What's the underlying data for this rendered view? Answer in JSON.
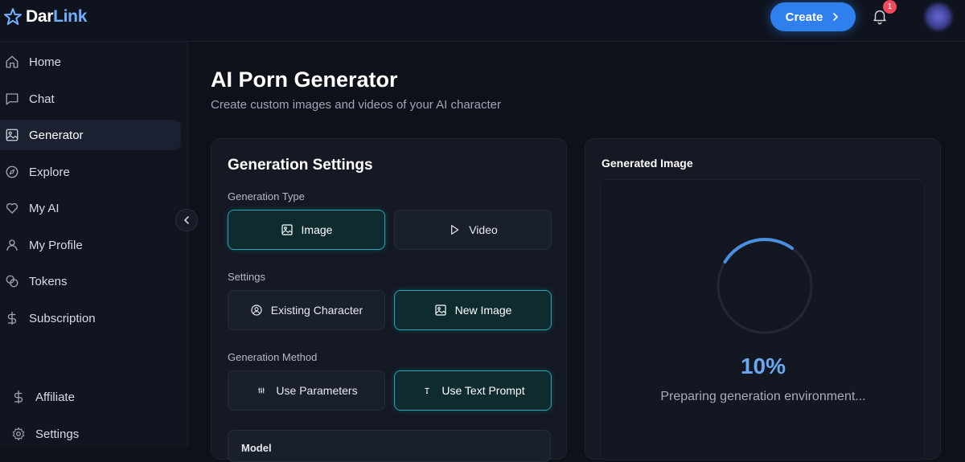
{
  "brand": {
    "name_part1": "Dar",
    "name_part2": "Link",
    "accent": "#6fb0ff"
  },
  "header": {
    "create_label": "Create",
    "notification_count": "1"
  },
  "sidebar": {
    "items": [
      {
        "label": "Home",
        "icon": "home-icon"
      },
      {
        "label": "Chat",
        "icon": "chat-icon"
      },
      {
        "label": "Generator",
        "icon": "image-icon",
        "active": true
      },
      {
        "label": "Explore",
        "icon": "compass-icon"
      },
      {
        "label": "My AI",
        "icon": "heart-icon"
      },
      {
        "label": "My Profile",
        "icon": "user-icon"
      },
      {
        "label": "Tokens",
        "icon": "coins-icon"
      },
      {
        "label": "Subscription",
        "icon": "dollar-icon"
      }
    ],
    "bottom_items": [
      {
        "label": "Affiliate",
        "icon": "dollar-icon"
      },
      {
        "label": "Settings",
        "icon": "gear-icon"
      }
    ]
  },
  "page": {
    "title": "AI Porn Generator",
    "subtitle": "Create custom images and videos of your AI character"
  },
  "settings": {
    "title": "Generation Settings",
    "generation_type": {
      "label": "Generation Type",
      "options": [
        {
          "label": "Image",
          "icon": "image-icon",
          "selected": true
        },
        {
          "label": "Video",
          "icon": "play-icon",
          "selected": false
        }
      ]
    },
    "settings_section": {
      "label": "Settings",
      "options": [
        {
          "label": "Existing Character",
          "icon": "user-circle-icon",
          "selected": false
        },
        {
          "label": "New Image",
          "icon": "image-icon",
          "selected": true
        }
      ]
    },
    "generation_method": {
      "label": "Generation Method",
      "options": [
        {
          "label": "Use Parameters",
          "icon": "sliders-icon",
          "selected": false
        },
        {
          "label": "Use Text Prompt",
          "icon": "text-icon",
          "selected": true
        }
      ]
    },
    "model_label": "Model"
  },
  "output": {
    "title": "Generated Image",
    "progress": 10,
    "progress_label": "10%",
    "status": "Preparing generation environment..."
  },
  "colors": {
    "primary": "#2f80ed",
    "selected_border": "#1fa7b8",
    "background": "#0e111a",
    "card": "#141924",
    "badge": "#ef4b5a"
  }
}
